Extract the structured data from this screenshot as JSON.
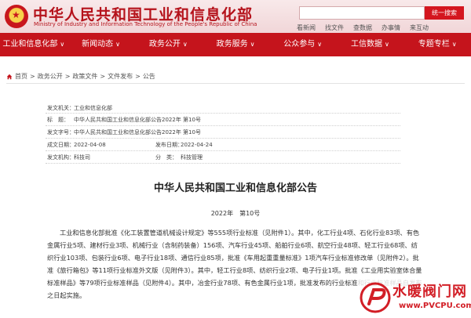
{
  "header": {
    "title": "中华人民共和国工业和信息化部",
    "subtitle": "Ministry of Industry and Information Technology of the People's Republic of China",
    "search_button": "统一搜索",
    "links": [
      "看新闻",
      "找文件",
      "查数据",
      "办事情",
      "来互动"
    ]
  },
  "nav": {
    "items": [
      "工业和信息化部",
      "新闻动态",
      "政务公开",
      "政务服务",
      "公众参与",
      "工信数据",
      "专题专栏"
    ],
    "caret": "∨"
  },
  "breadcrumb": {
    "items": [
      "首页",
      "政务公开",
      "政策文件",
      "文件发布",
      "公告"
    ],
    "separator": ">"
  },
  "meta": {
    "issuer_label": "发文机关：",
    "issuer": "工业和信息化部",
    "title_label": "标　题：",
    "title": "中华人民共和国工业和信息化部公告2022年 第10号",
    "number_label": "发文字号：",
    "number": "中华人民共和国工业和信息化部公告2022年 第10号",
    "date_label": "成文日期：",
    "date": "2022-04-08",
    "pub_label": "发布日期：",
    "pub_date": "2022-04-24",
    "org_label": "发文机构：",
    "org": "科技司",
    "cat_label": "分　类：",
    "cat": "科技管理"
  },
  "article": {
    "title": "中华人民共和国工业和信息化部公告",
    "number": "2022年　第10号",
    "body": "工业和信息化部批准《化工装置管道机械设计规定》等555项行业标准（见附件1）。其中，化工行业4项、石化行业83项、有色金属行业5项、建材行业3项、机械行业（含制药装备）156项、汽车行业45项、船舶行业6项、航空行业48项、轻工行业68项、纺织行业103项、包装行业6项、电子行业18项、通信行业85项，批准《车用起重重量标准》1项汽车行业标准修改单（见附件2）。批准《旅行箱包》等11项行业标准外文版（见附件3）。其中，轻工行业8项、纺织行业2项、电子行业1项。批准《工业用实验室体合量标准样品》等79项行业标准样品（见附件4）。其中，冶金行业78项、有色金属行业1项，批准发布的行业标准和行业标准样品自发布之日起实施。"
  },
  "watermark": {
    "text": "水暖阀门网",
    "url": "www.PVCPU.com"
  },
  "colors": {
    "brand_red": "#c5141c",
    "header_bg": "#f3dcde"
  }
}
